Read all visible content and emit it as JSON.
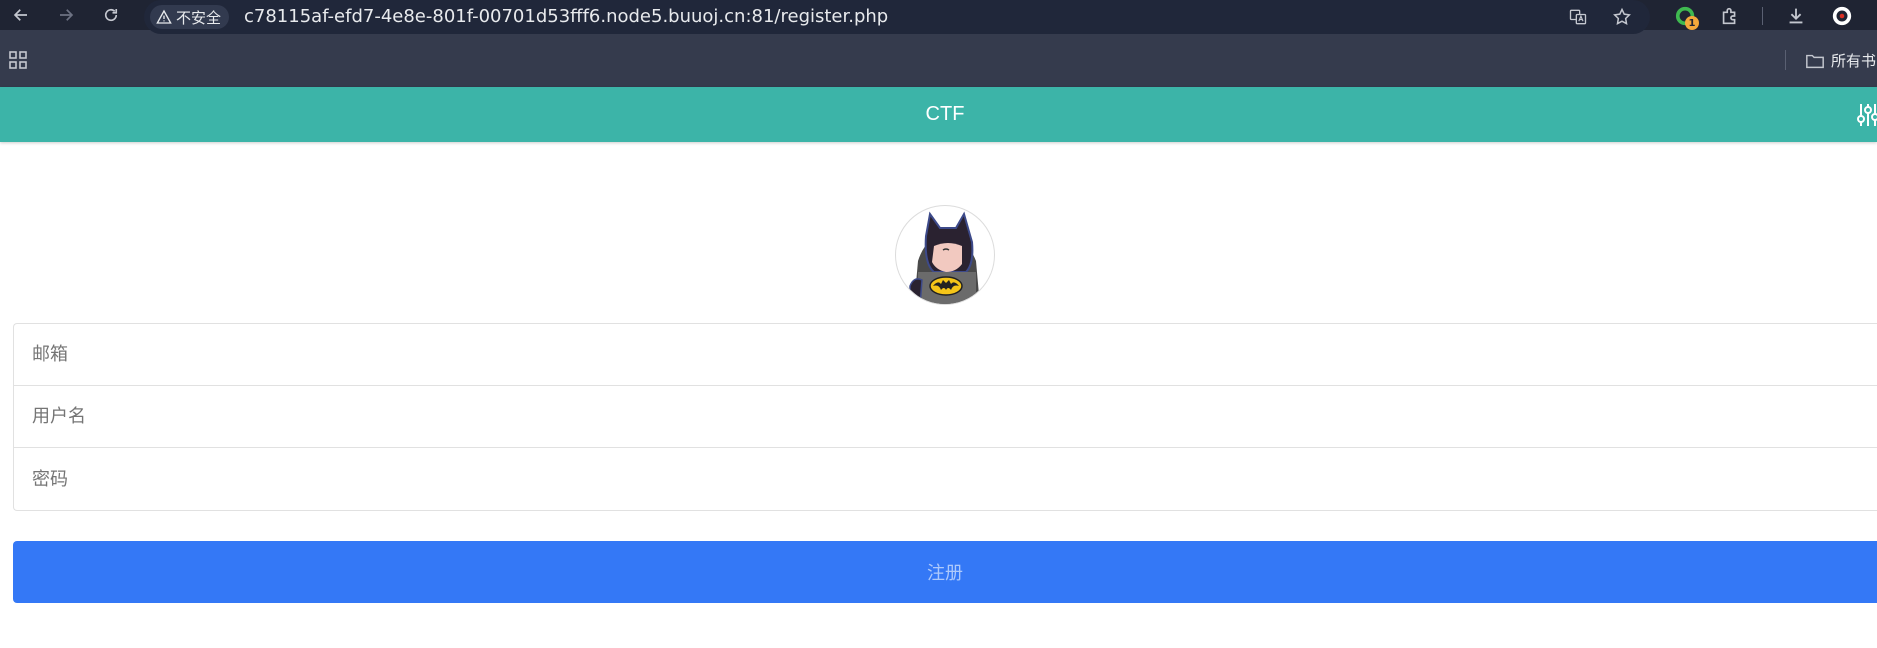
{
  "browser": {
    "security_label": "不安全",
    "url": "c78115af-efd7-4e8e-801f-00701d53fff6.node5.buuoj.cn:81/register.php",
    "extension_badge": "1",
    "bookmark_folder": "所有书"
  },
  "page": {
    "title": "CTF",
    "avatar": "batman-avatar",
    "form": {
      "email_placeholder": "邮箱",
      "username_placeholder": "用户名",
      "password_placeholder": "密码",
      "submit_label": "注册"
    }
  },
  "colors": {
    "appbar": "#3cb4a8",
    "button": "#3478f6"
  }
}
